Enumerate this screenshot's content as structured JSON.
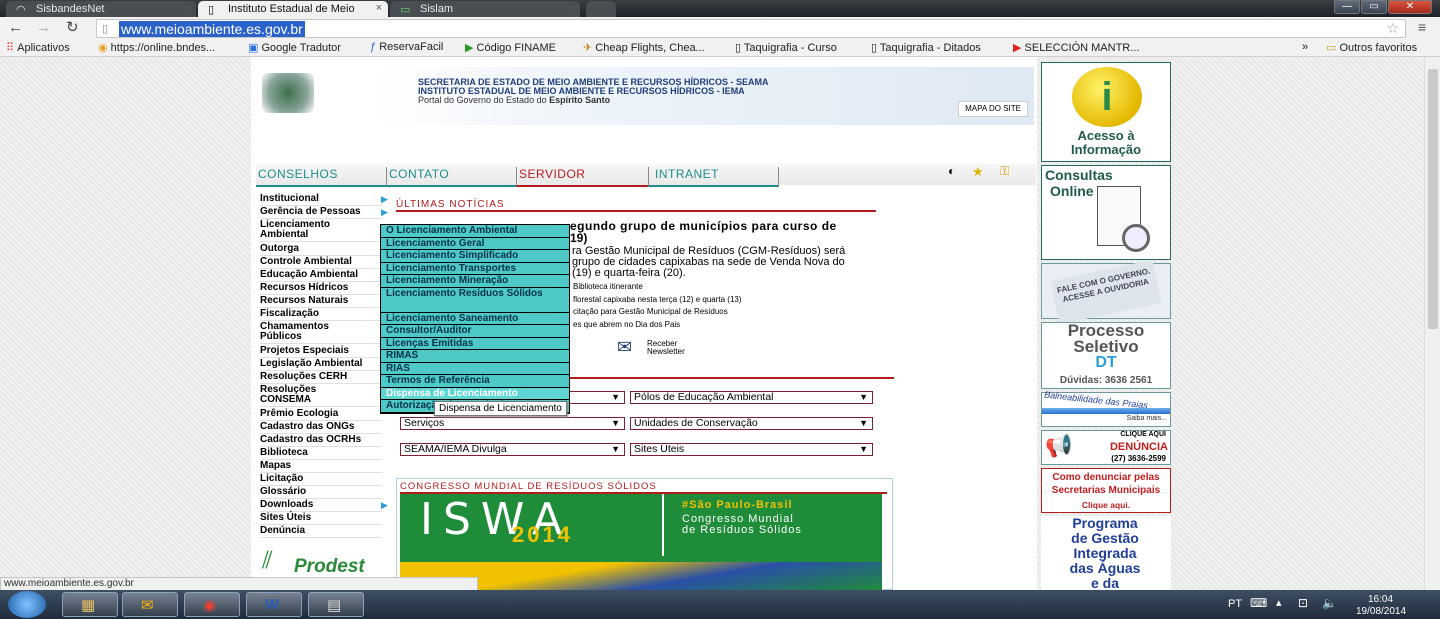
{
  "browser": {
    "tabs": [
      {
        "label": "SisbandesNet",
        "icon": "◠"
      },
      {
        "label": "Instituto Estadual de Meio",
        "icon": "▯"
      },
      {
        "label": "Sislam",
        "icon": "▭"
      },
      {
        "label": "",
        "icon": ""
      }
    ],
    "url": "www.meioambiente.es.gov.br",
    "bookmarks": [
      "Aplicativos",
      "https://online.bndes...",
      "Google Tradutor",
      "ReservaFacil",
      "Código FINAME",
      "Cheap Flights, Chea...",
      "Taquigrafia - Curso",
      "Taquigrafia - Ditados",
      "SELECCIÓN MANTR..."
    ],
    "bookmarks_more": "»",
    "other_bookmarks": "Outros favoritos",
    "status_url": "www.meioambiente.es.gov.br"
  },
  "header": {
    "line1": "SECRETARIA DE ESTADO DE MEIO AMBIENTE E RECURSOS HÍDRICOS - SEAMA",
    "line2": "INSTITUTO ESTADUAL DE MEIO AMBIENTE E RECURSOS HÍDRICOS - IEMA",
    "line3_prefix": "Portal do Governo do Estado do ",
    "line3_bold": "Espírito Santo",
    "mapa": "MAPA DO SITE"
  },
  "nav": [
    "CONSELHOS",
    "CONTATO",
    "SERVIDOR",
    "INTRANET"
  ],
  "left_menu": [
    {
      "label": "Institucional",
      "arrow": true
    },
    {
      "label": "Gerência de Pessoas",
      "arrow": true
    },
    {
      "label": "Licenciamento",
      "label2": "Ambiental",
      "arrow": false
    },
    {
      "label": "Outorga"
    },
    {
      "label": "Controle Ambiental"
    },
    {
      "label": "Educação Ambiental"
    },
    {
      "label": "Recursos Hídricos"
    },
    {
      "label": "Recursos Naturais"
    },
    {
      "label": "Fiscalização"
    },
    {
      "label": "Chamamentos",
      "label2": "Públicos"
    },
    {
      "label": "Projetos Especiais"
    },
    {
      "label": "Legislação Ambiental"
    },
    {
      "label": "Resoluções CERH"
    },
    {
      "label": "Resoluções",
      "label2": "CONSEMA"
    },
    {
      "label": "Prêmio Ecologia"
    },
    {
      "label": "Cadastro das ONGs"
    },
    {
      "label": "Cadastro das OCRHs"
    },
    {
      "label": "Biblioteca"
    },
    {
      "label": "Mapas"
    },
    {
      "label": "Licitação"
    },
    {
      "label": "Glossário"
    },
    {
      "label": "Downloads",
      "arrow": true
    },
    {
      "label": "Sites Úteis"
    },
    {
      "label": "Denúncia"
    }
  ],
  "prodest": "Prodest",
  "submenu": [
    "O Licenciamento Ambiental",
    "Licenciamento Geral",
    "Licenciamento Simplificado",
    "Licenciamento Transportes",
    "Licenciamento Mineração",
    "Licenciamento Resíduos Sólidos",
    "Licenciamento Saneamento",
    "Consultor/Auditor",
    "Licenças Emitidas",
    "RIMAS",
    "RIAS",
    "Termos de Referência",
    "Dispensa de Licenciamento",
    "Autorização de Manejo de Fauna"
  ],
  "tooltip": "Dispensa de Licenciamento",
  "news": {
    "section_title": "ÚLTIMAS NOTÍCIAS",
    "headline_a": "egundo grupo de municípios para curso de",
    "headline_b": "19)",
    "body1": "ra Gestão Municipal de Resíduos (CGM-Resíduos) será",
    "body2": "grupo de cidades capixabas na sede de Venda Nova do",
    "body3": "(19) e quarta-feira (20).",
    "item1": "Biblioteca itinerante",
    "item2": "florestal capixaba nesta terça (12) e quarta (13)",
    "item3": "citação para Gestão Municipal de Resíduos",
    "item4": "es que abrem no Dia dos Pais",
    "newsletter1": "Receber",
    "newsletter2": "Newsletter"
  },
  "selects": [
    "",
    "Pólos de Educação Ambiental",
    "Serviços",
    "Unidades de Conservação",
    "SEAMA/IEMA Divulga",
    "Sites Úteis"
  ],
  "congresso": {
    "title": "CONGRESSO MUNDIAL DE RESÍDUOS SÓLIDOS",
    "isws": "ISWA",
    "year": "2014",
    "hashtag": "#São Paulo-Brasil",
    "line1": "Congresso Mundial",
    "line2": "de Resíduos Sólidos"
  },
  "sidebar": {
    "acesso1": "Acesso à",
    "acesso2": "Informação",
    "consultas1": "Consultas",
    "consultas2": "Online",
    "fale": "FALE COM O GOVERNO. ACESSE A OUVIDORIA",
    "processo1": "Processo",
    "processo2": "Seletivo",
    "processo3": "DT",
    "duvidas": "Dúvidas: 3636 2561",
    "balnea": "Balneabilidade das Praias",
    "saiba": "Saiba mais...",
    "clique": "CLIQUE AQUI",
    "denuncia": "DENÚNCIA",
    "fone": "(27) 3636-2599",
    "como1": "Como denunciar pelas",
    "como2": "Secretarias Municipais",
    "clique2": "Clique aqui.",
    "programa": [
      "Programa",
      "de Gestão",
      "Integrada",
      "das Águas",
      "e da"
    ]
  },
  "taskbar": {
    "lang": "PT",
    "time": "16:04",
    "date": "19/08/2014"
  },
  "colors": {
    "accent": "#2a62c9",
    "menu": "#4ec9c7",
    "red": "#b31c1c"
  }
}
